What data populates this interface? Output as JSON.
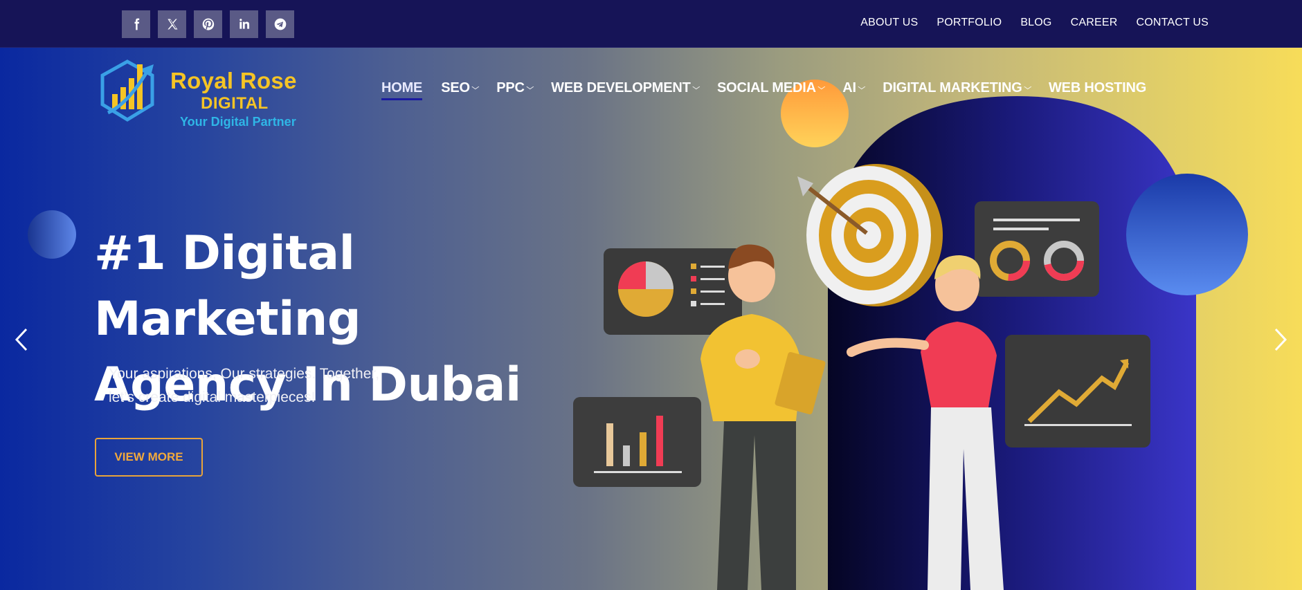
{
  "topbar": {
    "socials": [
      {
        "name": "facebook-icon"
      },
      {
        "name": "x-icon"
      },
      {
        "name": "pinterest-icon"
      },
      {
        "name": "linkedin-icon"
      },
      {
        "name": "telegram-icon"
      }
    ],
    "links": [
      "ABOUT US",
      "PORTFOLIO",
      "BLOG",
      "CAREER",
      "CONTACT US"
    ]
  },
  "logo": {
    "title": "Royal Rose",
    "subtitle": "DIGITAL",
    "tagline": "Your Digital Partner"
  },
  "nav": {
    "items": [
      {
        "label": "HOME",
        "active": true,
        "dropdown": false
      },
      {
        "label": "SEO",
        "active": false,
        "dropdown": true
      },
      {
        "label": "PPC",
        "active": false,
        "dropdown": true
      },
      {
        "label": "WEB DEVELOPMENT",
        "active": false,
        "dropdown": true
      },
      {
        "label": "SOCIAL MEDIA",
        "active": false,
        "dropdown": true
      },
      {
        "label": "AI",
        "active": false,
        "dropdown": true
      },
      {
        "label": "DIGITAL MARKETING",
        "active": false,
        "dropdown": true
      },
      {
        "label": "WEB HOSTING",
        "active": false,
        "dropdown": false
      }
    ]
  },
  "hero": {
    "headline_line1": "#1 Digital Marketing",
    "headline_line2": "Agency In Dubai",
    "subtext_line1": "Your aspirations, Our strategies. Together,",
    "subtext_line2": "let’s create digital masterpieces!",
    "button_label": "VIEW MORE",
    "prev_icon": "chevron-left-icon",
    "next_icon": "chevron-right-icon"
  },
  "colors": {
    "topbar_bg": "#161457",
    "accent_gold": "#f5c425",
    "button_orange": "#f2a93c",
    "logo_cyan": "#2fb6e6"
  }
}
